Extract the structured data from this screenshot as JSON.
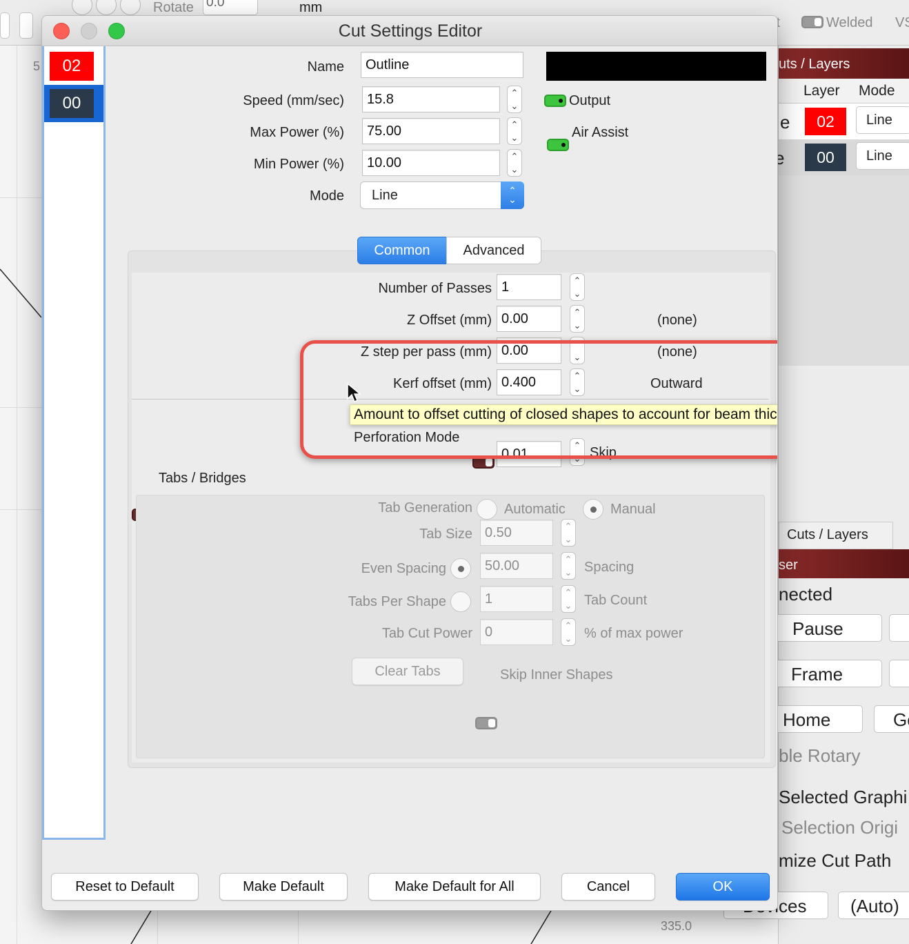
{
  "background": {
    "toolbar": {
      "rotate_label": "Rotate",
      "rotate_value": "0.0",
      "unit": "mm",
      "welded_label": "Welded",
      "partial_left": "ft",
      "partial_right": "VS"
    },
    "canvas": {
      "ruler_left": "5",
      "ruler_bottom": "335.0"
    },
    "panel": {
      "header": "uts / Layers",
      "col_layer": "Layer",
      "col_mode": "Mode",
      "rows": [
        {
          "prefix": "e",
          "layer": "02",
          "layer_color": "#ff0000",
          "mode": "Line"
        },
        {
          "prefix": "e",
          "layer": "00",
          "layer_color": "#2a3a4a",
          "mode": "Line"
        }
      ],
      "tab": "Cuts / Layers",
      "laser_header": "ser",
      "status": "nected",
      "pause": "Pause",
      "frame": "Frame",
      "home": "Home",
      "go": "Go",
      "rotary": "ble Rotary",
      "selected_graphics": "Selected Graphi",
      "selection_origin": "Selection Origi",
      "optimize": "mize Cut Path",
      "devices": "Devices",
      "auto": "(Auto)"
    }
  },
  "dialog": {
    "title": "Cut Settings Editor",
    "layers": [
      {
        "label": "02",
        "color": "#ff0000"
      },
      {
        "label": "00",
        "color": "#2a3a4a"
      }
    ],
    "name_label": "Name",
    "name_value": "Outline",
    "speed_label": "Speed (mm/sec)",
    "speed_value": "15.8",
    "max_power_label": "Max Power (%)",
    "max_power_value": "75.00",
    "min_power_label": "Min Power (%)",
    "min_power_value": "10.00",
    "mode_label": "Mode",
    "mode_value": "Line",
    "output_label": "Output",
    "air_assist_label": "Air Assist",
    "color_swatch": "#000000",
    "tabs": {
      "common": "Common",
      "advanced": "Advanced"
    },
    "common": {
      "passes_label": "Number of Passes",
      "passes_value": "1",
      "z_offset_label": "Z Offset (mm)",
      "z_offset_value": "0.00",
      "z_offset_note": "(none)",
      "z_step_label": "Z step per pass (mm)",
      "z_step_value": "0.00",
      "z_step_note": "(none)",
      "kerf_label": "Kerf offset (mm)",
      "kerf_value": "0.400",
      "kerf_note": "Outward",
      "tooltip": "Amount to offset cutting of closed shapes to account for beam thickness",
      "perforation_label": "Perforation Mode",
      "perf_value": "0.01",
      "perf_note": "Skip"
    },
    "tabs_bridges": {
      "label": "Tabs / Bridges",
      "generation_label": "Tab Generation",
      "automatic": "Automatic",
      "manual": "Manual",
      "size_label": "Tab Size",
      "size_value": "0.50",
      "even_spacing_label": "Even Spacing",
      "spacing_value": "50.00",
      "spacing_note": "Spacing",
      "per_shape_label": "Tabs Per Shape",
      "count_value": "1",
      "count_note": "Tab Count",
      "cut_power_label": "Tab Cut Power",
      "cut_power_value": "0",
      "cut_power_note": "% of max power",
      "clear_tabs": "Clear Tabs",
      "skip_inner": "Skip Inner Shapes"
    },
    "buttons": {
      "reset": "Reset to Default",
      "make_default": "Make Default",
      "make_default_all": "Make Default for All",
      "cancel": "Cancel",
      "ok": "OK"
    }
  }
}
